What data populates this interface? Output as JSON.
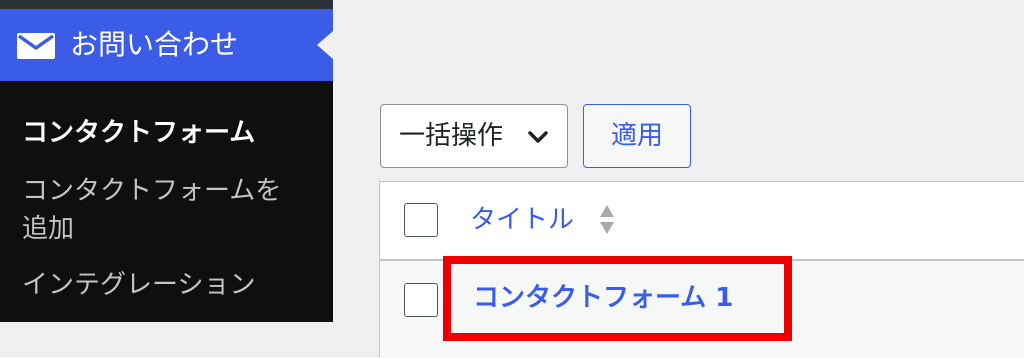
{
  "sidebar": {
    "active_menu": {
      "label": "お問い合わせ",
      "icon": "mail-icon"
    },
    "submenu": [
      {
        "label": "コンタクトフォーム",
        "current": true
      },
      {
        "label_line1": "コンタクトフォームを",
        "label_line2": "追加"
      },
      {
        "label": "インテグレーション"
      }
    ]
  },
  "toolbar": {
    "bulk_action_label": "一括操作",
    "apply_label": "適用"
  },
  "table": {
    "header_title": "タイトル",
    "rows": [
      {
        "title": "コンタクトフォーム 1"
      }
    ]
  },
  "colors": {
    "accent": "#3a5ce6",
    "sidebar_bg": "#0f0f0f",
    "highlight": "#ee0000"
  }
}
